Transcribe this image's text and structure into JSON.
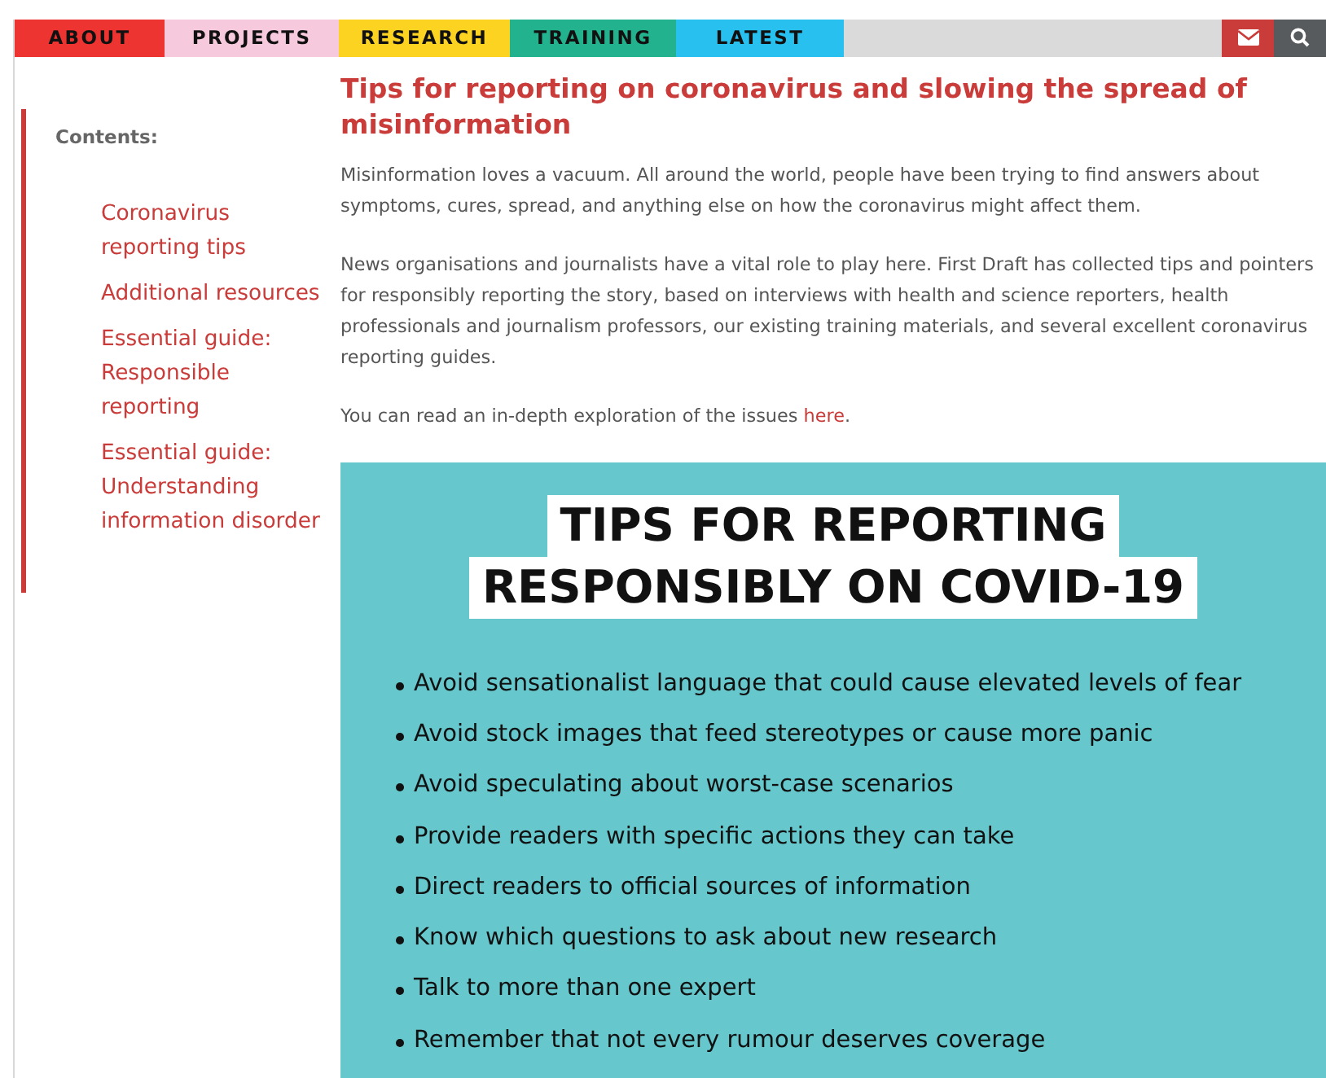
{
  "nav": {
    "tabs": [
      {
        "label": "ABOUT",
        "color": "#ee3431"
      },
      {
        "label": "PROJECTS",
        "color": "#f7c9dc"
      },
      {
        "label": "RESEARCH",
        "color": "#fcd321"
      },
      {
        "label": "TRAINING",
        "color": "#22b38e"
      },
      {
        "label": "LATEST",
        "color": "#27c0ef"
      }
    ]
  },
  "sidebar": {
    "heading": "Contents:",
    "links": [
      "Coronavirus reporting tips",
      "Additional resources",
      "Essential guide: Responsible reporting",
      "Essential guide: Understanding information disorder"
    ]
  },
  "article": {
    "title": "Tips for reporting on coronavirus and slowing the spread of misinformation",
    "paragraphs": [
      "Misinformation loves a vacuum. All around the world, people have been trying to find answers about symptoms, cures, spread, and anything else on how the coronavirus might affect them.",
      "News organisations and journalists have a vital role to play here. First Draft has collected tips and pointers for responsibly reporting the story, based on interviews with health and science reporters, health professionals and journalism professors, our existing training materials, and several excellent coronavirus reporting guides."
    ],
    "read_more": {
      "text": "You can read an in-depth exploration of the issues",
      "link": "here",
      "end": "."
    },
    "infographic": {
      "title_lines": [
        "TIPS FOR REPORTING",
        "RESPONSIBLY ON COVID-19"
      ],
      "tips": [
        "Avoid sensationalist language that could cause elevated levels of fear",
        "Avoid stock images that feed stereotypes or cause more panic",
        "Avoid speculating about worst-case scenarios",
        "Provide readers with specific actions they can take",
        "Direct readers to official sources of information",
        "Know which questions to ask about new research",
        "Talk to more than one expert",
        "Remember that not every rumour deserves coverage"
      ]
    }
  }
}
